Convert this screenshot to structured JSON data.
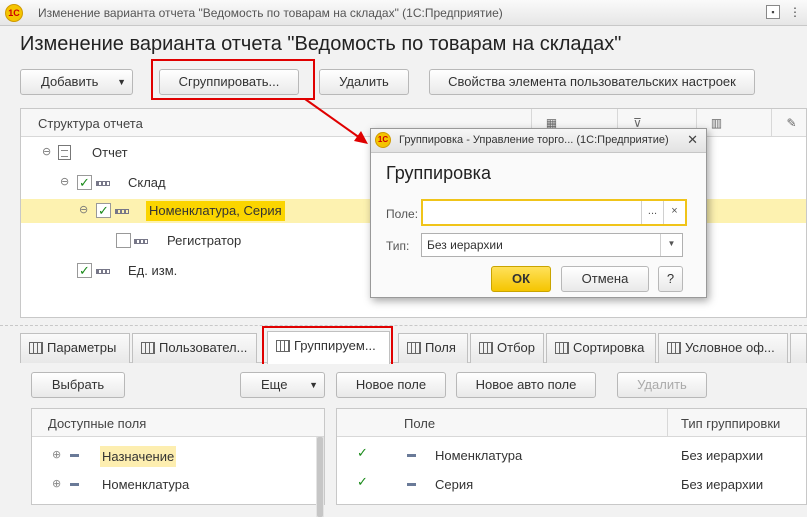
{
  "window": {
    "title": "Изменение варианта отчета \"Ведомость по товарам на складах\"  (1С:Предприятие)",
    "logo_text": "1С"
  },
  "page": {
    "title": "Изменение варианта отчета \"Ведомость по товарам на складах\""
  },
  "toolbar": {
    "add_label": "Добавить",
    "group_label": "Сгруппировать...",
    "delete_label": "Удалить",
    "props_label": "Свойства элемента пользовательских настроек"
  },
  "structure": {
    "header": "Структура отчета",
    "items": [
      {
        "label": "Отчет",
        "level": 0,
        "checked": null,
        "selected": false
      },
      {
        "label": "Склад",
        "level": 1,
        "checked": true,
        "selected": false
      },
      {
        "label": "Номенклатура, Серия",
        "level": 2,
        "checked": true,
        "selected": true
      },
      {
        "label": "Регистратор",
        "level": 3,
        "checked": false,
        "selected": false
      },
      {
        "label": "Ед. изм.",
        "level": 1,
        "checked": true,
        "selected": false
      }
    ]
  },
  "dialog": {
    "title": "Группировка - Управление торго... (1С:Предприятие)",
    "heading": "Группировка",
    "field_label": "Поле:",
    "field_value": "",
    "select_btn": "...",
    "clear_btn": "×",
    "type_label": "Тип:",
    "type_value": "Без иерархии",
    "ok_label": "ОК",
    "cancel_label": "Отмена",
    "help_label": "?"
  },
  "tabs": [
    {
      "label": "Параметры",
      "active": false
    },
    {
      "label": "Пользовател...",
      "active": false
    },
    {
      "label": "Группируем...",
      "active": true
    },
    {
      "label": "Поля",
      "active": false
    },
    {
      "label": "Отбор",
      "active": false
    },
    {
      "label": "Сортировка",
      "active": false
    },
    {
      "label": "Условное оф...",
      "active": false
    }
  ],
  "lower": {
    "choose_label": "Выбрать",
    "more_label": "Еще",
    "new_field_label": "Новое поле",
    "new_auto_field_label": "Новое авто поле",
    "delete_label": "Удалить",
    "available_fields_header": "Доступные поля",
    "available_fields": [
      {
        "label": "Назначение",
        "highlighted": true
      },
      {
        "label": "Номенклатура",
        "highlighted": false
      }
    ],
    "grouping_headers": {
      "field": "Поле",
      "type": "Тип группировки"
    },
    "grouping_rows": [
      {
        "field": "Номенклатура",
        "type": "Без иерархии",
        "checked": true
      },
      {
        "field": "Серия",
        "type": "Без иерархии",
        "checked": true
      }
    ]
  },
  "colors": {
    "highlight": "#fbd500",
    "selected_row": "#fdf2b0",
    "annotation_red": "#e00000",
    "ok_button": "#f5c500"
  }
}
